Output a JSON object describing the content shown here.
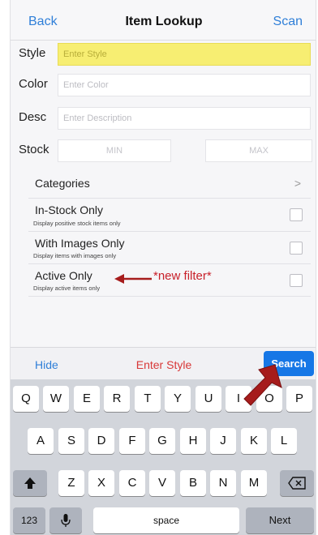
{
  "nav": {
    "back_label": "Back",
    "title": "Item Lookup",
    "scan_label": "Scan"
  },
  "form": {
    "style_label": "Style",
    "style_placeholder": "Enter Style",
    "color_label": "Color",
    "color_placeholder": "Enter Color",
    "desc_label": "Desc",
    "desc_placeholder": "Enter Description",
    "stock_label": "Stock",
    "min_placeholder": "MIN",
    "max_placeholder": "MAX"
  },
  "filters": {
    "categories_label": "Categories",
    "categories_chevron": ">",
    "items": [
      {
        "title": "In-Stock Only",
        "subtitle": "Display positive stock items only",
        "checked": false
      },
      {
        "title": "With Images Only",
        "subtitle": "Display items with images only",
        "checked": false
      },
      {
        "title": "Active Only",
        "subtitle": "Display active items only",
        "checked": false
      }
    ]
  },
  "annotation": {
    "text": "*new filter*",
    "color": "#c8202a"
  },
  "toolbar": {
    "hide_label": "Hide",
    "status_text": "Enter Style",
    "search_label": "Search"
  },
  "keyboard": {
    "row1": [
      "Q",
      "W",
      "E",
      "R",
      "T",
      "Y",
      "U",
      "I",
      "O",
      "P"
    ],
    "row2": [
      "A",
      "S",
      "D",
      "F",
      "G",
      "H",
      "J",
      "K",
      "L"
    ],
    "row3": [
      "Z",
      "X",
      "C",
      "V",
      "B",
      "N",
      "M"
    ],
    "numbers_label": "123",
    "space_label": "space",
    "next_label": "Next",
    "shift_icon": "shift-icon",
    "backspace_icon": "backspace-icon",
    "mic_icon": "microphone-icon"
  },
  "colors": {
    "accent": "#2f7fd8",
    "search_button": "#1677e6",
    "active_field": "#f7ee72",
    "status_red": "#d83838",
    "annotation_arrow": "#a61c1c"
  }
}
